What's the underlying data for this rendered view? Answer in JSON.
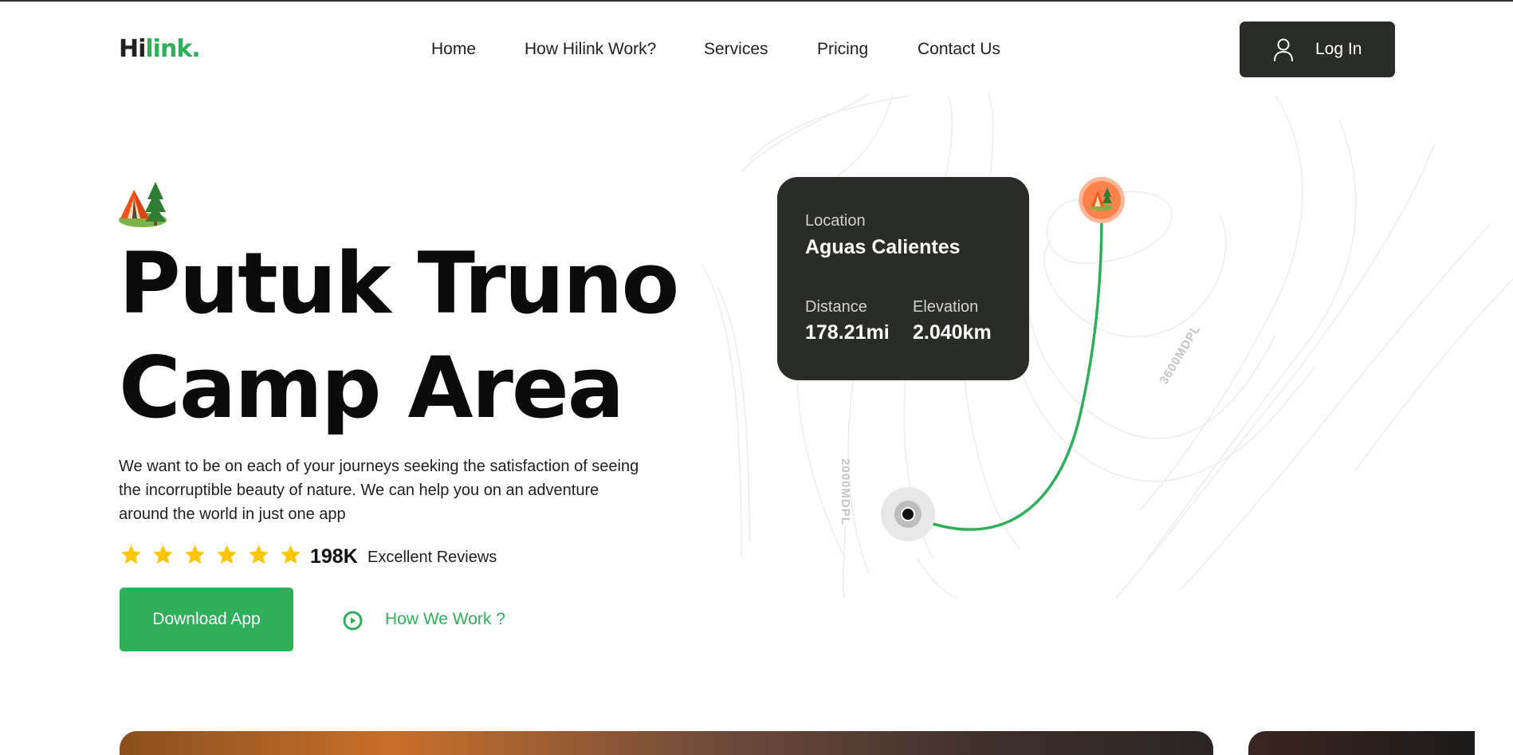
{
  "brand": {
    "logo_part1": "Hi",
    "logo_part2": "link."
  },
  "nav": {
    "items": [
      {
        "label": "Home"
      },
      {
        "label": "How Hilink Work?"
      },
      {
        "label": "Services"
      },
      {
        "label": "Pricing"
      },
      {
        "label": "Contact Us"
      }
    ]
  },
  "header": {
    "login_label": "Log In",
    "login_icon": "user-icon"
  },
  "hero": {
    "camp_icon": "camp-tent-icon",
    "title_line1": "Putuk Truno",
    "title_line2": "Camp Area",
    "description": "We want to be on each of your journeys seeking the satisfaction of seeing the incorruptible beauty of nature. We can help you on an adventure around the world in just one app",
    "rating_stars": 6,
    "reviews_count": "198K",
    "reviews_label": "Excellent Reviews",
    "download_label": "Download App",
    "how_label": "How We Work ?",
    "how_icon": "play-icon"
  },
  "map_card": {
    "location_label": "Location",
    "location_value": "Aguas Calientes",
    "distance_label": "Distance",
    "distance_value": "178.21mi",
    "elevation_label": "Elevation",
    "elevation_value": "2.040km"
  },
  "map": {
    "tag_low": "2000MDPL",
    "tag_high": "3600MDPL",
    "start_marker_icon": "start-location-icon",
    "destination_marker_icon": "camp-pin-icon"
  },
  "colors": {
    "brand_green": "#30AF5B",
    "dark": "#292C27",
    "star": "#FEC601",
    "pin_orange": "#FF814C",
    "background": "#FFFFFF"
  }
}
